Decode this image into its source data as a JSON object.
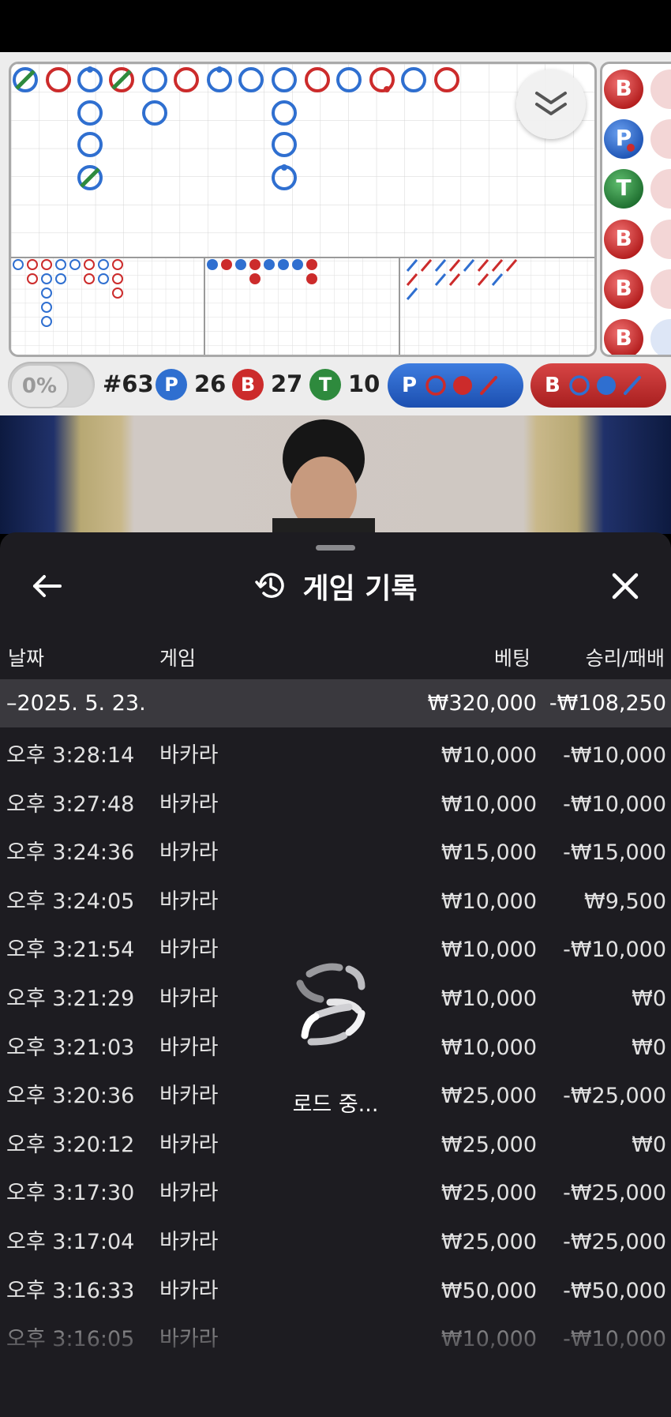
{
  "scoreboard": {
    "percent_label": "0%",
    "round_label": "#63",
    "player_badge": "P",
    "player_count": "26",
    "banker_badge": "B",
    "banker_count": "27",
    "tie_badge": "T",
    "tie_count": "10",
    "player_predict_label": "P",
    "banker_predict_label": "B",
    "bead_labels": [
      "B",
      "P",
      "T",
      "B",
      "B",
      "B"
    ],
    "colors": {
      "player": "#2f6fd0",
      "banker": "#cc2b2b",
      "tie": "#2e8a3d"
    }
  },
  "history": {
    "title": "게임 기록",
    "columns": {
      "date": "날짜",
      "game": "게임",
      "bet": "베팅",
      "result": "승리/패배"
    },
    "date_group": {
      "date": "–2025. 5. 23.",
      "bet_total": "₩320,000",
      "result_total": "-₩108,250"
    },
    "rows": [
      {
        "time": "오후 3:28:14",
        "game": "바카라",
        "bet": "₩10,000",
        "result": "-₩10,000"
      },
      {
        "time": "오후 3:27:48",
        "game": "바카라",
        "bet": "₩10,000",
        "result": "-₩10,000"
      },
      {
        "time": "오후 3:24:36",
        "game": "바카라",
        "bet": "₩15,000",
        "result": "-₩15,000"
      },
      {
        "time": "오후 3:24:05",
        "game": "바카라",
        "bet": "₩10,000",
        "result": "₩9,500"
      },
      {
        "time": "오후 3:21:54",
        "game": "바카라",
        "bet": "₩10,000",
        "result": "-₩10,000"
      },
      {
        "time": "오후 3:21:29",
        "game": "바카라",
        "bet": "₩10,000",
        "result": "₩0"
      },
      {
        "time": "오후 3:21:03",
        "game": "바카라",
        "bet": "₩10,000",
        "result": "₩0"
      },
      {
        "time": "오후 3:20:36",
        "game": "바카라",
        "bet": "₩25,000",
        "result": "-₩25,000"
      },
      {
        "time": "오후 3:20:12",
        "game": "바카라",
        "bet": "₩25,000",
        "result": "₩0"
      },
      {
        "time": "오후 3:17:30",
        "game": "바카라",
        "bet": "₩25,000",
        "result": "-₩25,000"
      },
      {
        "time": "오후 3:17:04",
        "game": "바카라",
        "bet": "₩25,000",
        "result": "-₩25,000"
      },
      {
        "time": "오후 3:16:33",
        "game": "바카라",
        "bet": "₩50,000",
        "result": "-₩50,000"
      },
      {
        "time": "오후 3:16:05",
        "game": "바카라",
        "bet": "₩10,000",
        "result": "-₩10,000"
      }
    ],
    "loading_text": "로드 중..."
  }
}
